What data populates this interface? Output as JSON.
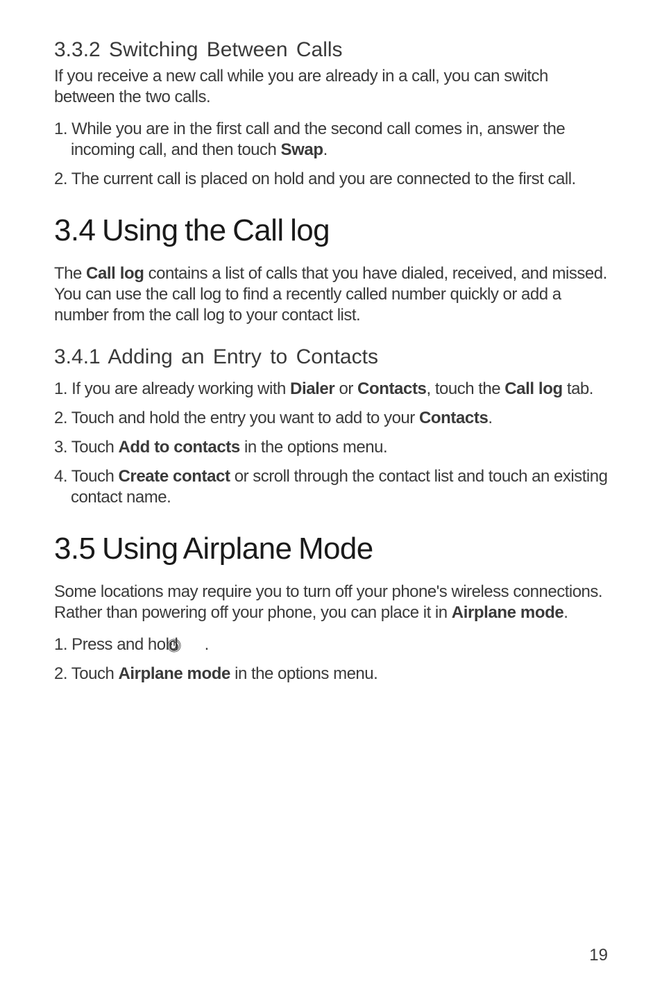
{
  "section_332": {
    "heading": "3.3.2  Switching Between Calls",
    "intro": "If you receive a new call while you are already in a call, you can switch between the two calls.",
    "step1_pre": "1. While you are in the first call and the second call comes in, answer the incoming call, and then touch ",
    "step1_bold": "Swap",
    "step1_post": ".",
    "step2": "2. The current call is placed on hold and you are connected to the first call."
  },
  "section_34": {
    "heading": "3.4  Using the Call log",
    "intro_pre": "The ",
    "intro_bold": "Call log",
    "intro_post": " contains a list of calls that you have dialed, received, and missed. You can use the call log to find a recently called number quickly or add a number from the call log to your contact list."
  },
  "section_341": {
    "heading": "3.4.1  Adding an Entry to Contacts",
    "step1_pre": "1. If you are already working with ",
    "step1_b1": "Dialer",
    "step1_mid": " or ",
    "step1_b2": "Contacts",
    "step1_mid2": ", touch the ",
    "step1_b3": "Call log",
    "step1_post": " tab.",
    "step2_pre": "2. Touch and hold the entry you want to add to your ",
    "step2_b1": "Contacts",
    "step2_post": ".",
    "step3_pre": "3. Touch ",
    "step3_b1": "Add to contacts",
    "step3_post": " in the options menu.",
    "step4_pre": "4. Touch ",
    "step4_b1": "Create contact",
    "step4_post": " or scroll through the contact list and touch an existing contact name."
  },
  "section_35": {
    "heading": "3.5  Using Airplane Mode",
    "intro_pre": "Some locations may require you to turn off your phone's wireless connections. Rather than powering off your phone, you can place it in ",
    "intro_b1": "Airplane mode",
    "intro_post": ".",
    "step1_pre": "1. Press and hold ",
    "step1_post": " .",
    "step2_pre": "2. Touch ",
    "step2_b1": "Airplane mode",
    "step2_post": " in the options menu."
  },
  "page_number": "19"
}
